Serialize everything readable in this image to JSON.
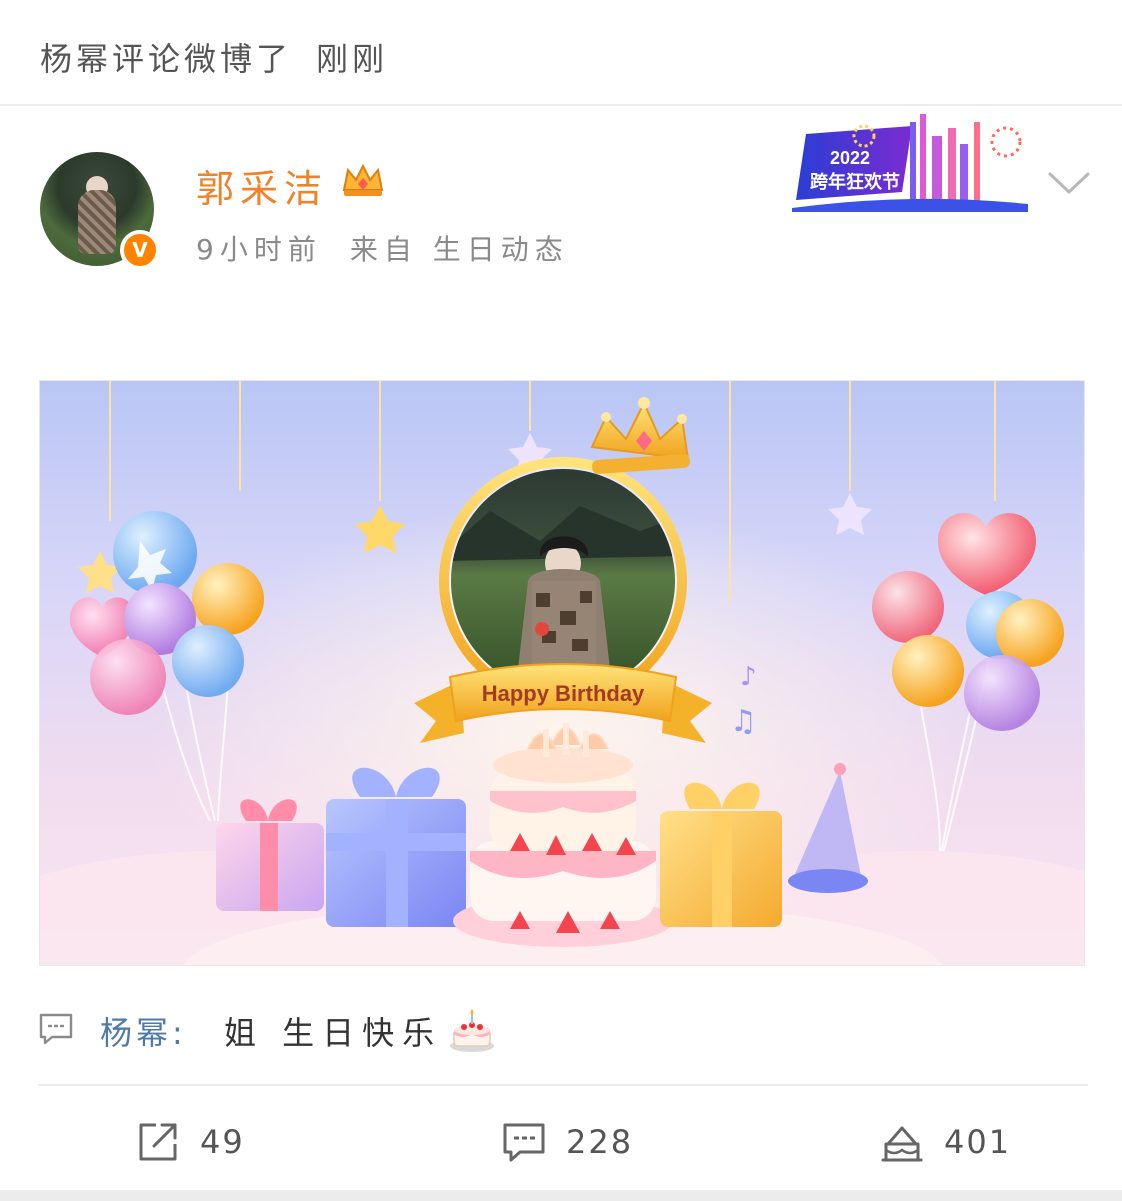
{
  "activity": {
    "text": "杨幂评论微博了",
    "time": "刚刚"
  },
  "post": {
    "username": "郭采洁",
    "time_ago": "9小时前",
    "source": "来自 生日动态",
    "event_badge": {
      "year": "2022",
      "title": "跨年狂欢节"
    }
  },
  "banner": {
    "ribbon_text": "Happy Birthday"
  },
  "comment": {
    "author": "杨幂:",
    "text": "姐 生日快乐",
    "emoji": "cake-emoji"
  },
  "actions": {
    "repost_count": "49",
    "comment_count": "228",
    "like_count": "401"
  },
  "colors": {
    "username": "#f08228",
    "verified": "#ff8200",
    "comment_author": "#4d7aa6"
  }
}
